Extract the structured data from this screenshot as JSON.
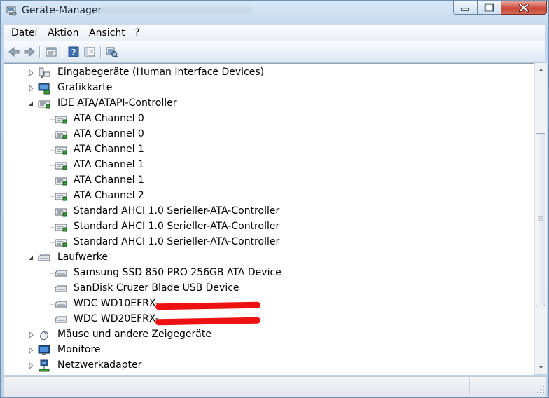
{
  "window": {
    "title": "Geräte-Manager",
    "app_icon": "device-manager-icon"
  },
  "menu": {
    "items": [
      "Datei",
      "Aktion",
      "Ansicht",
      "?"
    ]
  },
  "toolbar": {
    "buttons": [
      "back-icon",
      "forward-icon",
      "properties-view-icon",
      "help-icon",
      "show-hide-console-tree-icon",
      "scan-hardware-icon"
    ]
  },
  "tree": {
    "nodes": [
      {
        "label": "Eingabegeräte (Human Interface Devices)",
        "expander": "collapsed",
        "icon": "keyboard-device-icon"
      },
      {
        "label": "Grafikkarte",
        "expander": "collapsed",
        "icon": "display-adapter-icon"
      },
      {
        "label": "IDE ATA/ATAPI-Controller",
        "expander": "expanded",
        "icon": "controller-icon"
      },
      {
        "label": "ATA Channel 0",
        "icon": "controller-icon"
      },
      {
        "label": "ATA Channel 0",
        "icon": "controller-icon"
      },
      {
        "label": "ATA Channel 1",
        "icon": "controller-icon"
      },
      {
        "label": "ATA Channel 1",
        "icon": "controller-icon"
      },
      {
        "label": "ATA Channel 1",
        "icon": "controller-icon"
      },
      {
        "label": "ATA Channel 2",
        "icon": "controller-icon"
      },
      {
        "label": "Standard AHCI 1.0 Serieller-ATA-Controller",
        "icon": "controller-icon"
      },
      {
        "label": "Standard AHCI 1.0 Serieller-ATA-Controller",
        "icon": "controller-icon"
      },
      {
        "label": "Standard AHCI 1.0 Serieller-ATA-Controller",
        "icon": "controller-icon"
      },
      {
        "label": "Laufwerke",
        "expander": "expanded",
        "icon": "disk-drive-icon"
      },
      {
        "label": "Samsung SSD 850 PRO 256GB ATA Device",
        "icon": "disk-drive-icon"
      },
      {
        "label": "SanDisk Cruzer Blade USB Device",
        "icon": "disk-drive-icon"
      },
      {
        "label": "WDC WD10EFRX-",
        "icon": "disk-drive-icon",
        "redacted": true
      },
      {
        "label": "WDC WD20EFRX-",
        "icon": "disk-drive-icon",
        "redacted": true
      },
      {
        "label": "Mäuse und andere Zeigegeräte",
        "expander": "collapsed",
        "icon": "mouse-icon"
      },
      {
        "label": "Monitore",
        "expander": "collapsed",
        "icon": "monitor-icon"
      },
      {
        "label": "Netzwerkadapter",
        "expander": "collapsed",
        "icon": "network-adapter-icon"
      }
    ]
  },
  "colors": {
    "redaction": "#e11111",
    "frame": "#c3d8ee"
  }
}
